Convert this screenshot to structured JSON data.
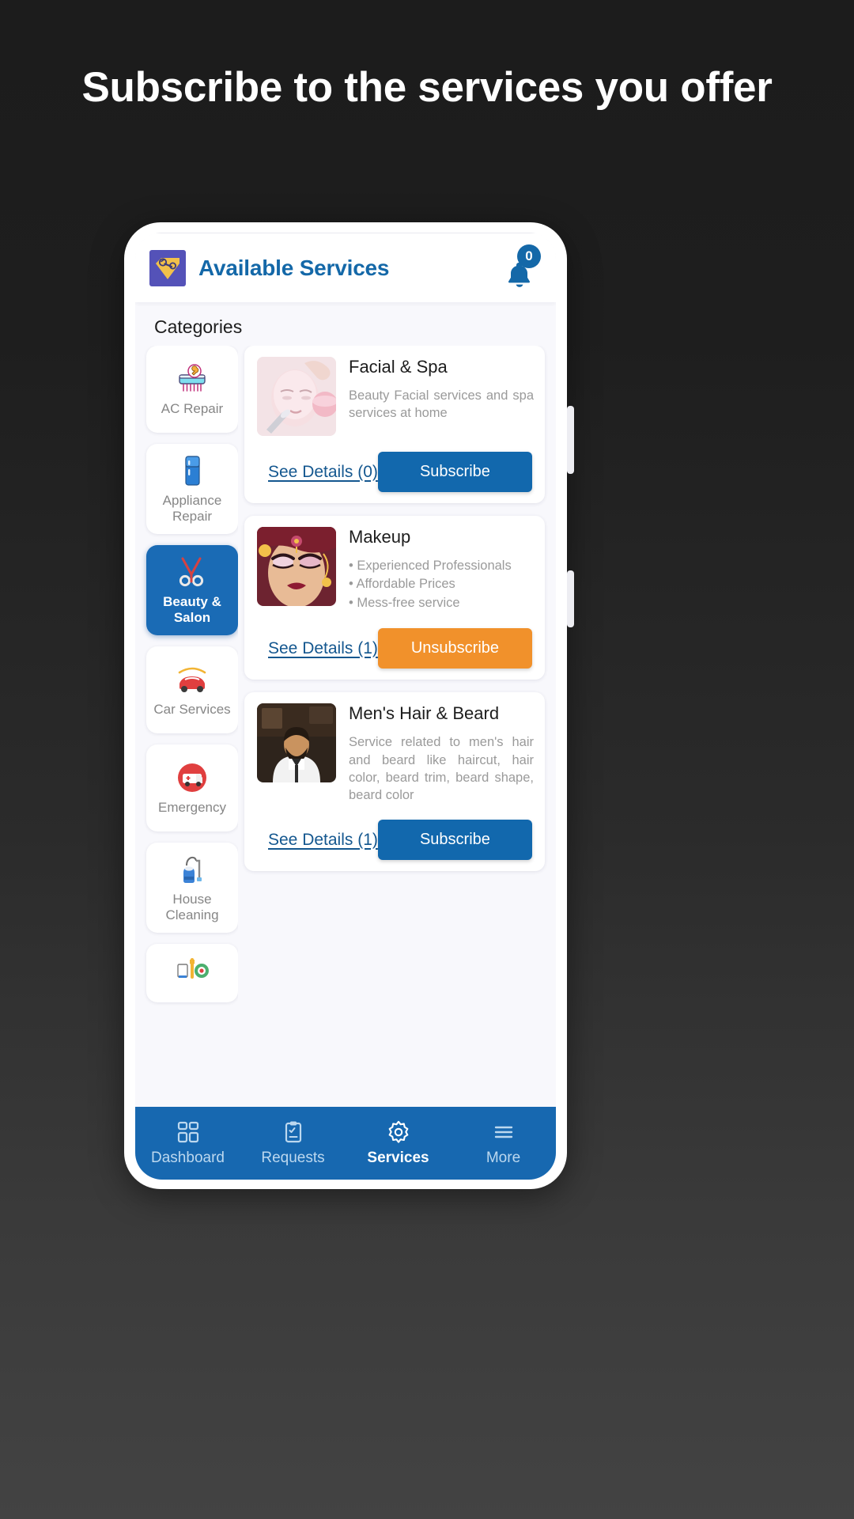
{
  "promo": {
    "headline": "Subscribe to the services you offer"
  },
  "appbar": {
    "logo_icon": "tools-diamond-logo-icon",
    "title": "Available Services",
    "bell_icon": "notification-bell-icon",
    "badge_count": "0"
  },
  "content": {
    "categories_heading": "Categories"
  },
  "categories": [
    {
      "label": "AC Repair",
      "icon": "ac-repair-icon",
      "active": false
    },
    {
      "label": "Appliance Repair",
      "icon": "appliance-repair-icon",
      "active": false
    },
    {
      "label": "Beauty & Salon",
      "icon": "beauty-salon-icon",
      "active": true
    },
    {
      "label": "Car Services",
      "icon": "car-services-icon",
      "active": false
    },
    {
      "label": "Emergency",
      "icon": "emergency-icon",
      "active": false
    },
    {
      "label": "House Cleaning",
      "icon": "house-cleaning-icon",
      "active": false
    },
    {
      "label": "",
      "icon": "home-repair-icon",
      "active": false
    }
  ],
  "services": [
    {
      "title": "Facial & Spa",
      "thumb": "facial-spa-photo",
      "description": "Beauty Facial services and spa services at home",
      "bullets": [],
      "details_label": "See Details (0)",
      "action_label": "Subscribe",
      "action_state": "subscribe"
    },
    {
      "title": "Makeup",
      "thumb": "makeup-photo",
      "description": "",
      "bullets": [
        "• Experienced Professionals",
        "• Affordable Prices",
        "• Mess-free service"
      ],
      "details_label": "See Details (1)",
      "action_label": "Unsubscribe",
      "action_state": "unsubscribe"
    },
    {
      "title": "Men's Hair & Beard",
      "thumb": "mens-hair-beard-photo",
      "description": "Service related to men's hair and beard like haircut, hair color, beard trim, beard shape, beard color",
      "bullets": [],
      "details_label": "See Details (1)",
      "action_label": "Subscribe",
      "action_state": "subscribe"
    }
  ],
  "bottom_nav": [
    {
      "label": "Dashboard",
      "icon": "dashboard-grid-icon",
      "active": false
    },
    {
      "label": "Requests",
      "icon": "clipboard-list-icon",
      "active": false
    },
    {
      "label": "Services",
      "icon": "gear-icon",
      "active": true
    },
    {
      "label": "More",
      "icon": "hamburger-menu-icon",
      "active": false
    }
  ],
  "colors": {
    "background": "#1e1e1e",
    "brand_blue": "#1468a8",
    "nav_blue": "#1768b0",
    "active_category": "#1a6bb5",
    "unsubscribe_orange": "#f1912b",
    "logo_purple": "#5452b8",
    "logo_gold": "#f2c14a"
  }
}
